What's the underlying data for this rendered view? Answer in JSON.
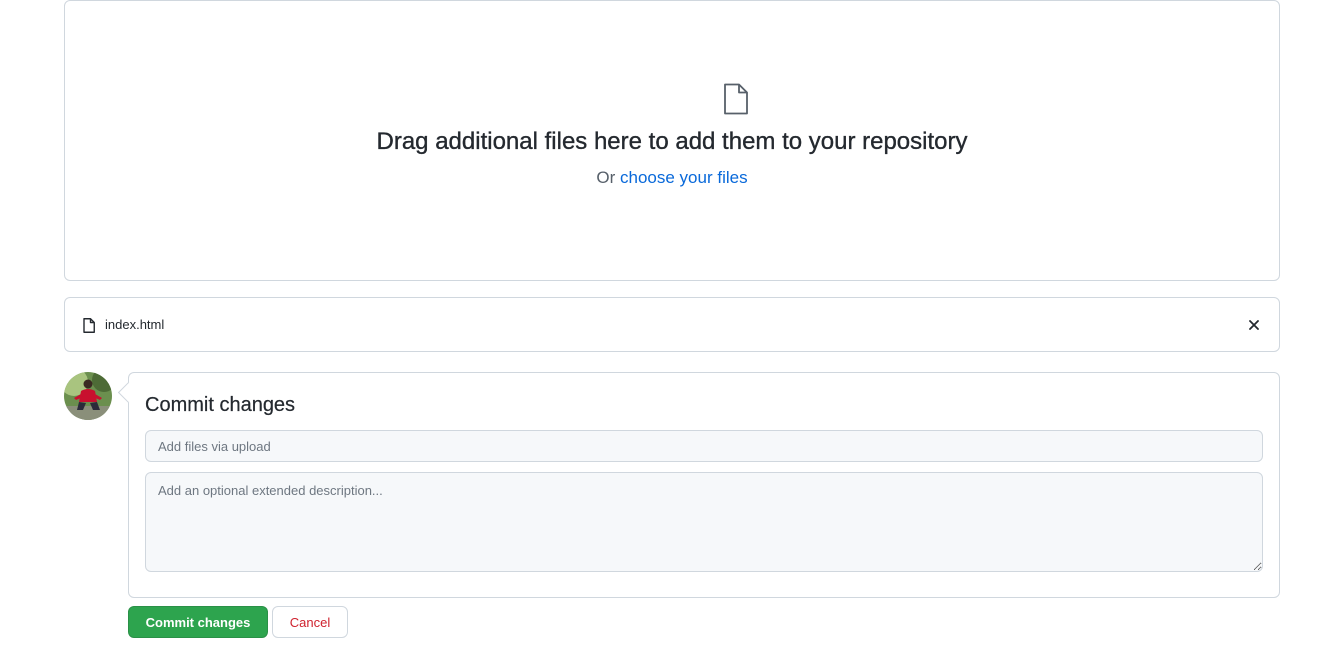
{
  "upload": {
    "icon": "file-icon",
    "title": "Drag additional files here to add them to your repository",
    "sub_prefix": "Or",
    "choose_link": "choose your files"
  },
  "files": [
    {
      "name": "index.html",
      "icon": "file-icon",
      "remove_icon": "x-icon"
    }
  ],
  "commit": {
    "avatar": "user-avatar",
    "title": "Commit changes",
    "summary_placeholder": "Add files via upload",
    "summary_value": "",
    "description_placeholder": "Add an optional extended description...",
    "description_value": "",
    "commit_button": "Commit changes",
    "cancel_button": "Cancel"
  },
  "colors": {
    "primary_button": "#2da44e",
    "cancel_text": "#cf222e",
    "link": "#0969da",
    "border": "#d0d7de"
  }
}
